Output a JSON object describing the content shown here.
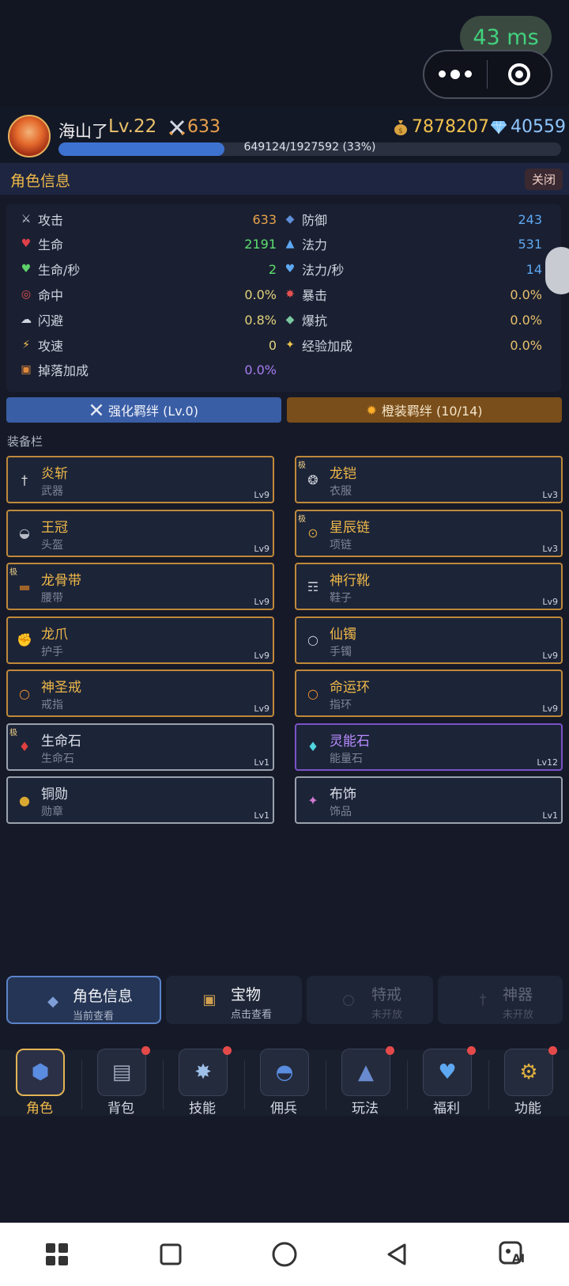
{
  "status": {
    "ping": "43 ms"
  },
  "player": {
    "name": "海山了",
    "level": "Lv.22",
    "power": "633",
    "gold": "7878207",
    "gems": "40559",
    "exp_text": "649124/1927592 (33%)",
    "exp_fraction": 0.33
  },
  "panel": {
    "title": "角色信息",
    "close_label": "关闭"
  },
  "stats": {
    "left": [
      {
        "icon": "swords-icon",
        "label": "攻击",
        "value": "633",
        "color": "#e9a24b"
      },
      {
        "icon": "heart-icon",
        "label": "生命",
        "value": "2191",
        "color": "#5ee06e"
      },
      {
        "icon": "heart-green-icon",
        "label": "生命/秒",
        "value": "2",
        "color": "#5ee06e"
      },
      {
        "icon": "target-icon",
        "label": "命中",
        "value": "0.0%",
        "color": "#e4d27a"
      },
      {
        "icon": "dodge-icon",
        "label": "闪避",
        "value": "0.8%",
        "color": "#e4d27a"
      },
      {
        "icon": "lightning-icon",
        "label": "攻速",
        "value": "0",
        "color": "#e4d27a"
      },
      {
        "icon": "gift-icon",
        "label": "掉落加成",
        "value": "0.0%",
        "color": "#a77cf0"
      }
    ],
    "right": [
      {
        "icon": "shield-icon",
        "label": "防御",
        "value": "243",
        "color": "#5ea8f2"
      },
      {
        "icon": "drop-icon",
        "label": "法力",
        "value": "531",
        "color": "#5ea8f2"
      },
      {
        "icon": "heart-blue-icon",
        "label": "法力/秒",
        "value": "14",
        "color": "#5ea8f2"
      },
      {
        "icon": "burst-icon",
        "label": "暴击",
        "value": "0.0%",
        "color": "#e9c06b"
      },
      {
        "icon": "resist-icon",
        "label": "爆抗",
        "value": "0.0%",
        "color": "#e9c06b"
      },
      {
        "icon": "sparkle-icon",
        "label": "经验加成",
        "value": "0.0%",
        "color": "#e9c06b"
      }
    ]
  },
  "bonds": {
    "enhance": "强化羁绊 (Lv.0)",
    "orange": "橙装羁绊 (10/14)"
  },
  "equipment": {
    "label": "装备栏",
    "slots": [
      {
        "name": "炎斩",
        "type": "武器",
        "level": "Lv9",
        "rarity": "gold",
        "badge": ""
      },
      {
        "name": "龙铠",
        "type": "衣服",
        "level": "Lv3",
        "rarity": "gold",
        "badge": "极"
      },
      {
        "name": "王冠",
        "type": "头盔",
        "level": "Lv9",
        "rarity": "gold",
        "badge": ""
      },
      {
        "name": "星辰链",
        "type": "项链",
        "level": "Lv3",
        "rarity": "gold",
        "badge": "极"
      },
      {
        "name": "龙骨带",
        "type": "腰带",
        "level": "Lv9",
        "rarity": "gold",
        "badge": "极"
      },
      {
        "name": "神行靴",
        "type": "鞋子",
        "level": "Lv9",
        "rarity": "gold",
        "badge": ""
      },
      {
        "name": "龙爪",
        "type": "护手",
        "level": "Lv9",
        "rarity": "gold",
        "badge": ""
      },
      {
        "name": "仙镯",
        "type": "手镯",
        "level": "Lv9",
        "rarity": "gold",
        "badge": ""
      },
      {
        "name": "神圣戒",
        "type": "戒指",
        "level": "Lv9",
        "rarity": "gold",
        "badge": ""
      },
      {
        "name": "命运环",
        "type": "指环",
        "level": "Lv9",
        "rarity": "gold",
        "badge": ""
      },
      {
        "name": "生命石",
        "type": "生命石",
        "level": "Lv1",
        "rarity": "plain",
        "badge": "极"
      },
      {
        "name": "灵能石",
        "type": "能量石",
        "level": "Lv12",
        "rarity": "purple",
        "badge": ""
      },
      {
        "name": "铜勋",
        "type": "勋章",
        "level": "Lv1",
        "rarity": "plain",
        "badge": ""
      },
      {
        "name": "布饰",
        "type": "饰品",
        "level": "Lv1",
        "rarity": "plain",
        "badge": ""
      }
    ]
  },
  "tabs": [
    {
      "title": "角色信息",
      "sub": "当前查看",
      "state": "active"
    },
    {
      "title": "宝物",
      "sub": "点击查看",
      "state": "normal"
    },
    {
      "title": "特戒",
      "sub": "未开放",
      "state": "disabled"
    },
    {
      "title": "神器",
      "sub": "未开放",
      "state": "disabled"
    }
  ],
  "nav": [
    {
      "label": "角色",
      "icon": "character-icon",
      "active": true,
      "badge": false
    },
    {
      "label": "背包",
      "icon": "backpack-icon",
      "active": false,
      "badge": true
    },
    {
      "label": "技能",
      "icon": "skill-icon",
      "active": false,
      "badge": true
    },
    {
      "label": "佣兵",
      "icon": "mercenary-icon",
      "active": false,
      "badge": false
    },
    {
      "label": "玩法",
      "icon": "gameplay-icon",
      "active": false,
      "badge": true
    },
    {
      "label": "福利",
      "icon": "welfare-icon",
      "active": false,
      "badge": true
    },
    {
      "label": "功能",
      "icon": "function-icon",
      "active": false,
      "badge": true
    }
  ],
  "system_nav": {
    "ai_label": "AI"
  }
}
